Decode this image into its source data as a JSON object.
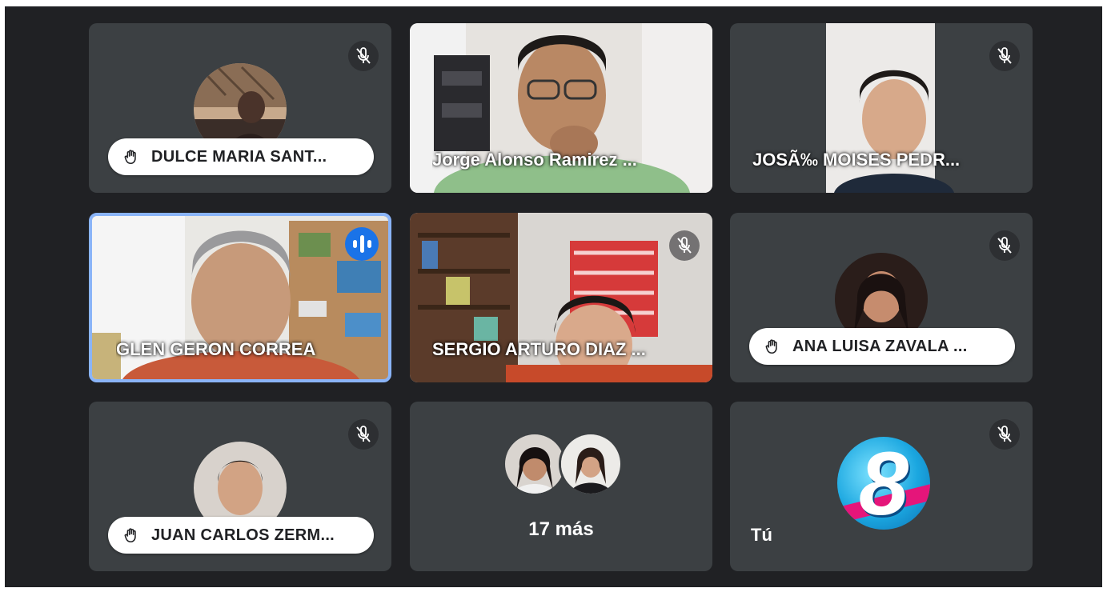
{
  "participants": [
    {
      "name": "DULCE MARIA SANT...",
      "muted": true,
      "hand_raised": true
    },
    {
      "name": "Jorge Alonso Ramirez ...",
      "muted": false
    },
    {
      "name": "JOSÃ‰ MOISES PEDR...",
      "muted": true
    },
    {
      "name": "GLEN GERON CORREA",
      "muted": false,
      "speaking": true
    },
    {
      "name": "SERGIO ARTURO DIAZ ...",
      "muted": true
    },
    {
      "name": "ANA LUISA ZAVALA ...",
      "muted": true,
      "hand_raised": true
    },
    {
      "name": "JUAN CARLOS ZERM...",
      "muted": true,
      "hand_raised": true
    }
  ],
  "more": {
    "label": "17 más"
  },
  "self": {
    "label": "Tú",
    "muted": true,
    "avatar_text": "8"
  },
  "colors": {
    "background": "#202124",
    "tile": "#3c4043",
    "speaking_border": "#8ab4f8",
    "speaking_badge": "#1a73e8"
  },
  "icons": {
    "mute": "mic-off-icon",
    "hand": "hand-raised-icon",
    "speaking": "audio-level-icon"
  }
}
